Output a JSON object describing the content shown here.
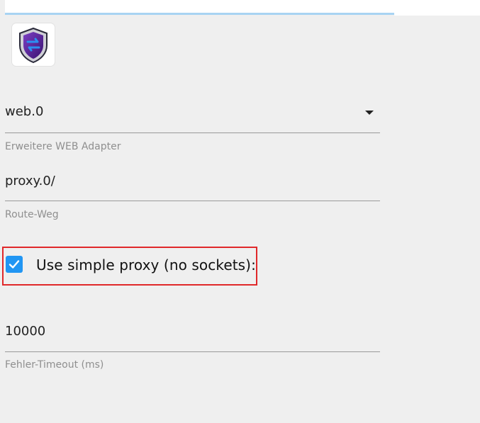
{
  "logo": {
    "icon": "shield-swap-icon"
  },
  "web_adapter": {
    "value": "web.0",
    "helper": "Erweitere WEB Adapter"
  },
  "route": {
    "value": "proxy.0/",
    "helper": "Route-Weg"
  },
  "simple_proxy": {
    "label": "Use simple proxy (no sockets):",
    "checked": true
  },
  "error_timeout": {
    "value": "10000",
    "helper": "Fehler-Timeout (ms)"
  },
  "colors": {
    "accent": "#2196f3",
    "highlight": "#e0282a",
    "background": "#efefef"
  }
}
